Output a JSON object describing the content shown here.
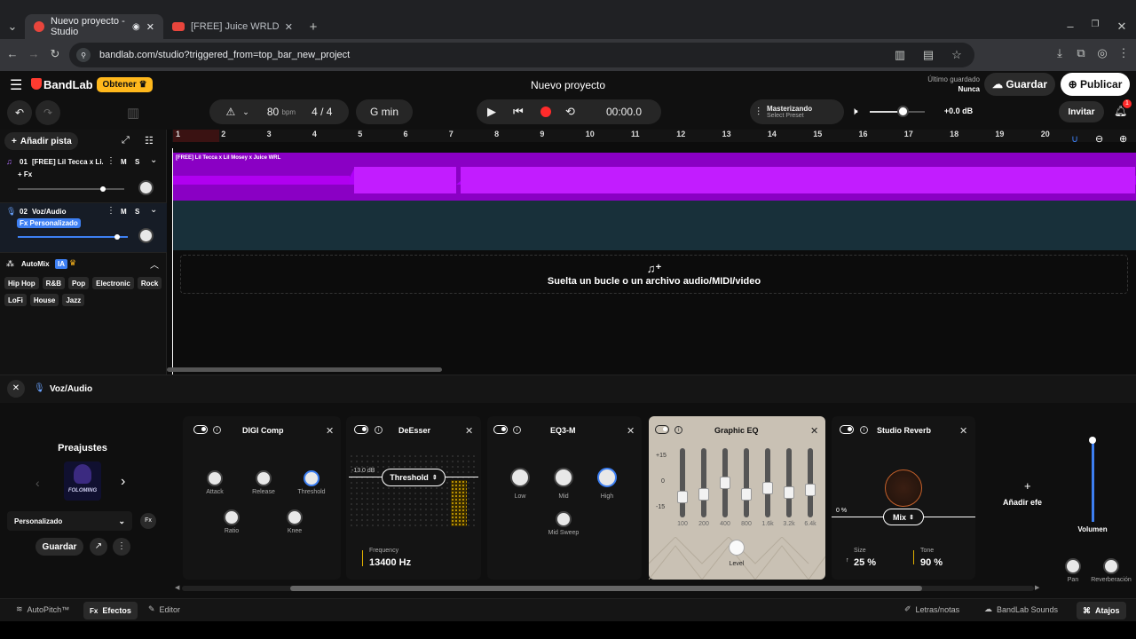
{
  "browser": {
    "tabs": [
      {
        "title": "Nuevo proyecto - Studio"
      },
      {
        "title": "[FREE] Juice WRLD x Lil Tecca Ty"
      }
    ],
    "url": "bandlab.com/studio?triggered_from=top_bar_new_project"
  },
  "app": {
    "logo": "BandLab",
    "get_pro": "Obtener",
    "project_title": "Nuevo proyecto",
    "last_saved_label": "Último guardado",
    "last_saved_value": "Nunca",
    "save": "Guardar",
    "publish": "Publicar",
    "invite": "Invitar",
    "notification_count": "1"
  },
  "transport": {
    "bpm": "80",
    "bpm_unit": "bpm",
    "time_sig_num": "4",
    "time_sig_sep": "/",
    "time_sig_den": "4",
    "key": "G min",
    "time": "00:00.0",
    "mastering_title": "Masterizando",
    "mastering_sub": "Select Preset",
    "master_volume": "+0.0 dB",
    "master_volume_level": 0.6
  },
  "tracks": {
    "add_track": "Añadir pista",
    "items": [
      {
        "number": "01",
        "name": "[FREE] Lil Tecca x Li...",
        "fx": "+ Fx",
        "mute": "M",
        "solo": "S",
        "volume": 0.8
      },
      {
        "number": "02",
        "name": "Voz/Audio",
        "fx": "Fx Personalizado",
        "mute": "M",
        "solo": "S",
        "volume": 0.9
      }
    ],
    "automix_label": "AutoMix",
    "automix_badge": "IA",
    "genres": [
      "Hip Hop",
      "R&B",
      "Pop",
      "Electronic",
      "Rock",
      "LoFi",
      "House",
      "Jazz"
    ]
  },
  "timeline": {
    "bars": [
      "1",
      "2",
      "3",
      "4",
      "5",
      "6",
      "7",
      "8",
      "9",
      "10",
      "11",
      "12",
      "13",
      "14",
      "15",
      "16",
      "17",
      "18",
      "19",
      "20"
    ],
    "region_label": "[FREE] Lil Tecca x Lil Mosey x Juice WRL",
    "drop_text": "Suelta un bucle o un archivo audio/MIDI/video"
  },
  "fx": {
    "track_name": "Voz/Audio",
    "presets_title": "Preajustes",
    "preset_art": "FOLOMING",
    "preset_select": "Personalizado",
    "save_preset": "Guardar",
    "add_effect": "Añadir efe",
    "volume_label": "Volumen",
    "pan_label": "Pan",
    "reverb_label": "Reverberación",
    "cards": {
      "digicomp": {
        "title": "DIGI Comp",
        "knobs": [
          "Attack",
          "Release",
          "Threshold",
          "Ratio",
          "Knee"
        ]
      },
      "deesser": {
        "title": "DeEsser",
        "threshold_db": "-13.0 dB",
        "dropdown": "Threshold",
        "freq_label": "Frequency",
        "freq_value": "13400 Hz"
      },
      "eq3": {
        "title": "EQ3-M",
        "knobs": [
          "Low",
          "Mid",
          "High",
          "Mid Sweep"
        ]
      },
      "graphiceq": {
        "title": "Graphic EQ",
        "scale": [
          "+15",
          "0",
          "-15"
        ],
        "bands": [
          "100",
          "200",
          "400",
          "800",
          "1.6k",
          "3.2k",
          "6.4k"
        ],
        "band_gains": [
          0,
          0.1,
          0.5,
          0.1,
          0.3,
          0.15,
          0.25
        ],
        "level_label": "Level"
      },
      "reverb": {
        "title": "Studio Reverb",
        "mix_pct": "0 %",
        "mix_dropdown": "Mix",
        "size_label": "Size",
        "size_value": "25 %",
        "tone_label": "Tone",
        "tone_value": "90 %"
      }
    }
  },
  "bottom": {
    "autopitch": "AutoPitch™",
    "effects_prefix": "Fx",
    "effects": "Efectos",
    "editor": "Editor",
    "lyrics": "Letras/notas",
    "sounds": "BandLab Sounds",
    "shortcuts": "Atajos"
  }
}
